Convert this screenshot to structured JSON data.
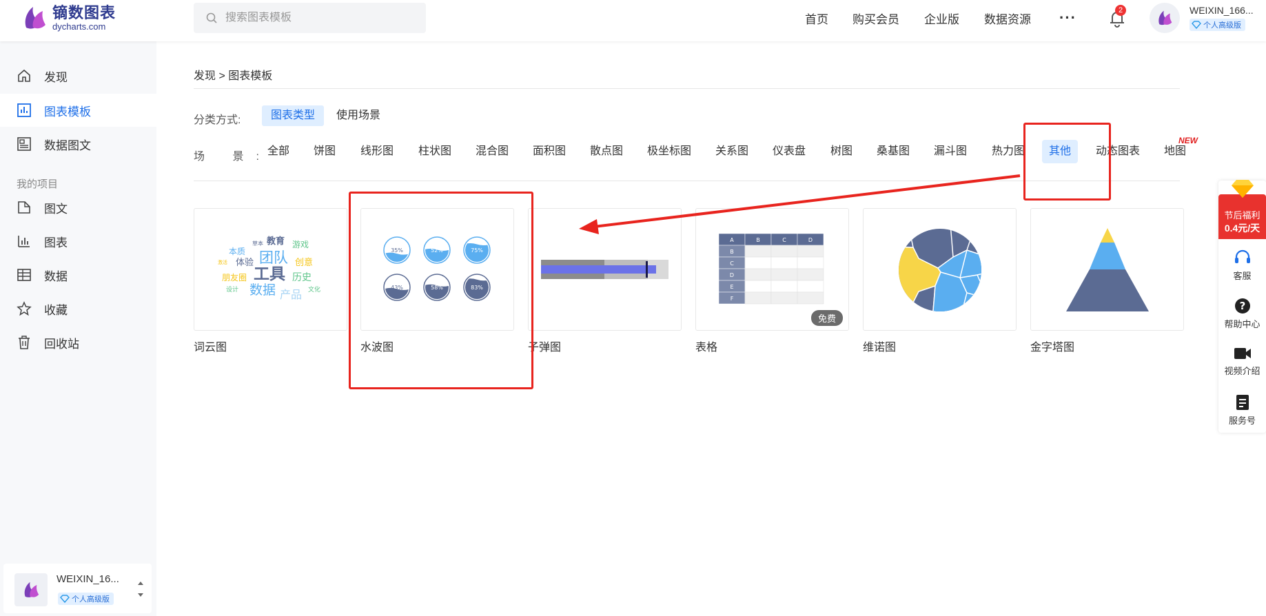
{
  "header": {
    "logo_cn": "镝数图表",
    "logo_en": "dycharts.com",
    "search_placeholder": "搜索图表模板",
    "nav": [
      "首页",
      "购买会员",
      "企业版",
      "数据资源"
    ],
    "more": "···",
    "notification_count": "2",
    "username": "WEIXIN_166...",
    "vip_label": "个人高级版"
  },
  "sidebar": {
    "items": [
      "发现",
      "图表模板",
      "数据图文"
    ],
    "group_title": "我的项目",
    "project_items": [
      "图文",
      "图表",
      "数据",
      "收藏",
      "回收站"
    ],
    "user": {
      "name": "WEIXIN_16...",
      "vip": "个人高级版"
    }
  },
  "main": {
    "breadcrumb": "发现 > 图表模板",
    "classify_label": "分类方式:",
    "classify_options": [
      "图表类型",
      "使用场景"
    ],
    "scene_label": "场 景:",
    "tags": [
      "全部",
      "饼图",
      "线形图",
      "柱状图",
      "混合图",
      "面积图",
      "散点图",
      "极坐标图",
      "关系图",
      "仪表盘",
      "树图",
      "桑基图",
      "漏斗图",
      "热力图",
      "其他",
      "动态图表",
      "地图"
    ],
    "active_tag": "其他",
    "new_badge": "NEW",
    "cards": [
      {
        "title": "词云图"
      },
      {
        "title": "水波图",
        "liquid_values": [
          "35%",
          "52%",
          "75%",
          "43%",
          "58%",
          "83%"
        ]
      },
      {
        "title": "子弹图"
      },
      {
        "title": "表格",
        "badge": "免费",
        "table_headers": [
          "A",
          "B",
          "C",
          "D"
        ],
        "table_rows": [
          "B",
          "C",
          "D",
          "E",
          "F"
        ]
      },
      {
        "title": "维诺图"
      },
      {
        "title": "金字塔图"
      }
    ],
    "wordcloud_words": [
      "教育",
      "草本",
      "游戏",
      "本质",
      "团队",
      "创意",
      "激活",
      "体验",
      "工具",
      "历史",
      "朋友圈",
      "设计",
      "数据",
      "产品",
      "文化"
    ]
  },
  "rightbar": {
    "promo_line1": "节后福利",
    "promo_line2": "0.4元/天",
    "items": [
      "客服",
      "帮助中心",
      "视频介绍",
      "服务号"
    ]
  },
  "colors": {
    "accent": "#1e6fe8",
    "annotation": "#e8241e",
    "chart_navy": "#5b6b93",
    "chart_blue": "#5aaef0",
    "chart_yellow": "#f7d548"
  }
}
